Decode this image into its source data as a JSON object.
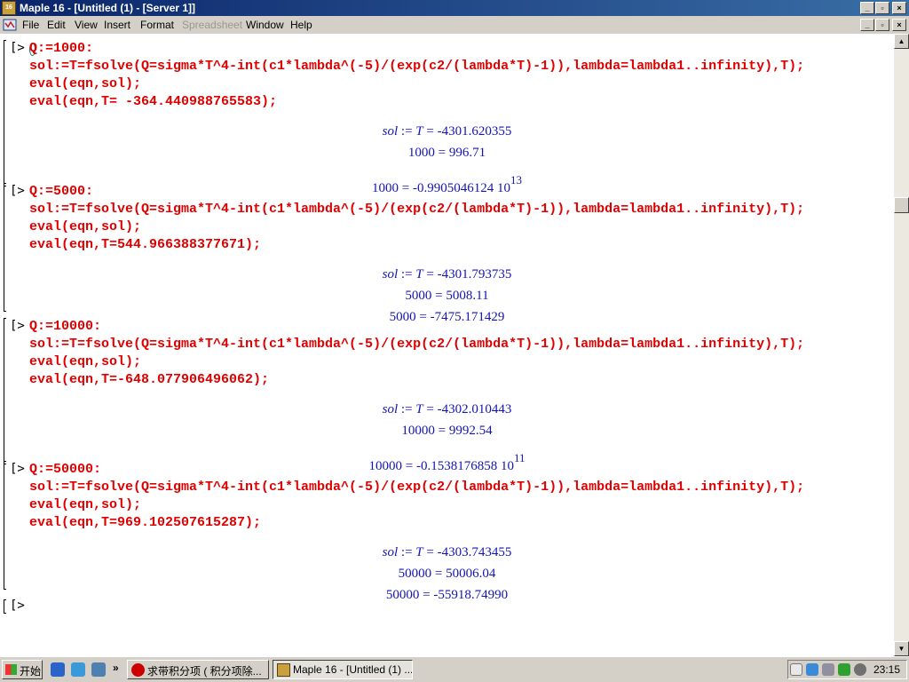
{
  "window": {
    "title": "Maple 16  - [Untitled (1) - [Server 1]]"
  },
  "icons": {
    "app_icon": "maple-leaf-icon",
    "app_icon_text": "16",
    "doc_icon": "document-icon",
    "minimize": "minimize-icon",
    "restore": "restore-icon",
    "close": "close-icon"
  },
  "menu": {
    "items": [
      "File",
      "Edit",
      "View",
      "Insert",
      "Format",
      "Spreadsheet",
      "Window",
      "Help"
    ],
    "disabled": [
      "Spreadsheet"
    ]
  },
  "prompt_symbol": "[>",
  "groups": [
    {
      "input": [
        "Q:=1000:",
        "sol:=T=fsolve(Q=sigma*T^4-int(c1*lambda^(-5)/(exp(c2/(lambda*T)-1)),lambda=lambda1..infinity),T);",
        "eval(eqn,sol);",
        "eval(eqn,T= -364.440988765583);"
      ],
      "sol_lhs": "sol",
      "sol_var": "T",
      "sol_value": "-4301.620355",
      "eq1_lhs": "1000",
      "eq1_rhs": "996.71",
      "eq2_lhs": "1000",
      "eq2_rhs": "-0.9905046124 10",
      "eq2_exp": "13"
    },
    {
      "input": [
        "Q:=5000:",
        "sol:=T=fsolve(Q=sigma*T^4-int(c1*lambda^(-5)/(exp(c2/(lambda*T)-1)),lambda=lambda1..infinity),T);",
        "eval(eqn,sol);",
        "eval(eqn,T=544.966388377671);"
      ],
      "sol_lhs": "sol",
      "sol_var": "T",
      "sol_value": "-4301.793735",
      "eq1_lhs": "5000",
      "eq1_rhs": "5008.11",
      "eq2_lhs": "5000",
      "eq2_rhs": "-7475.171429",
      "eq2_exp": ""
    },
    {
      "input": [
        "Q:=10000:",
        "sol:=T=fsolve(Q=sigma*T^4-int(c1*lambda^(-5)/(exp(c2/(lambda*T)-1)),lambda=lambda1..infinity),T);",
        "eval(eqn,sol);",
        "eval(eqn,T=-648.077906496062);"
      ],
      "sol_lhs": "sol",
      "sol_var": "T",
      "sol_value": "-4302.010443",
      "eq1_lhs": "10000",
      "eq1_rhs": "9992.54",
      "eq2_lhs": "10000",
      "eq2_rhs": "-0.1538176858 10",
      "eq2_exp": "11"
    },
    {
      "input": [
        "Q:=50000:",
        "sol:=T=fsolve(Q=sigma*T^4-int(c1*lambda^(-5)/(exp(c2/(lambda*T)-1)),lambda=lambda1..infinity),T);",
        "eval(eqn,sol);",
        "eval(eqn,T=969.102507615287);"
      ],
      "sol_lhs": "sol",
      "sol_var": "T",
      "sol_value": "-4303.743455",
      "eq1_lhs": "50000",
      "eq1_rhs": "50006.04",
      "eq2_lhs": "50000",
      "eq2_rhs": "-55918.74990",
      "eq2_exp": ""
    }
  ],
  "taskbar": {
    "start_label": "开始",
    "start_icon": "windows-flag-icon",
    "quicklaunch": [
      "internet-explorer-icon",
      "outlook-express-icon",
      "windows-media-icon"
    ],
    "more": "»",
    "tasks": [
      {
        "label": "求带积分项 ( 积分项除...",
        "icon": "opera-browser-icon",
        "active": false
      },
      {
        "label": "Maple 16  - [Untitled (1) ...",
        "icon": "maple-app-icon",
        "active": true
      }
    ],
    "tray_icons": [
      "keyboard-icon",
      "network-icon",
      "printer-icon",
      "update-icon",
      "volume-icon"
    ],
    "clock": "23:15"
  }
}
